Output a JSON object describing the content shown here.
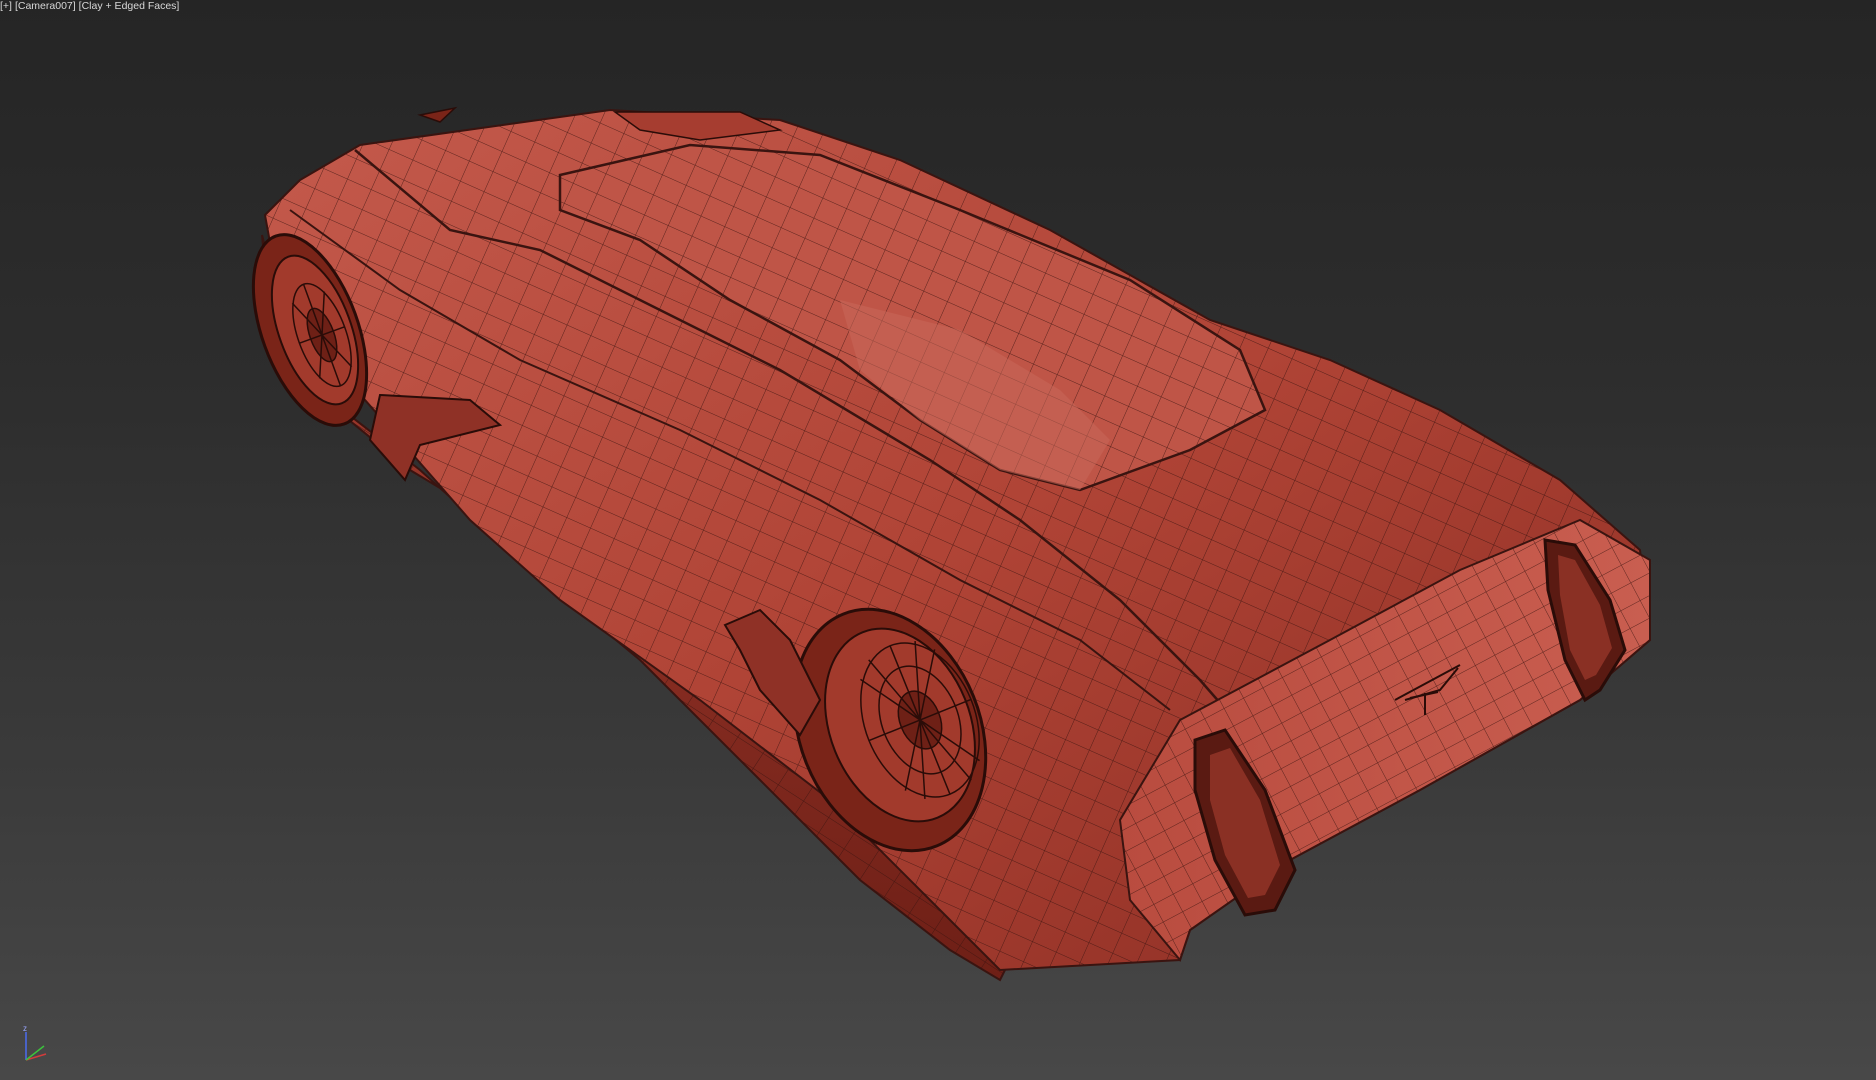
{
  "viewport": {
    "label": {
      "menu": "[+]",
      "camera": "[Camera007]",
      "shading": "[Clay + Edged Faces]"
    },
    "background_top": "#252525",
    "background_bottom": "#484848"
  },
  "model": {
    "material_color": "#b5483c",
    "wire_color": "#3a1410"
  },
  "axis_gizmo": {
    "x_color": "#d23c3c",
    "y_color": "#3cc23c",
    "z_color": "#4a6cf0",
    "z_label": "z"
  }
}
